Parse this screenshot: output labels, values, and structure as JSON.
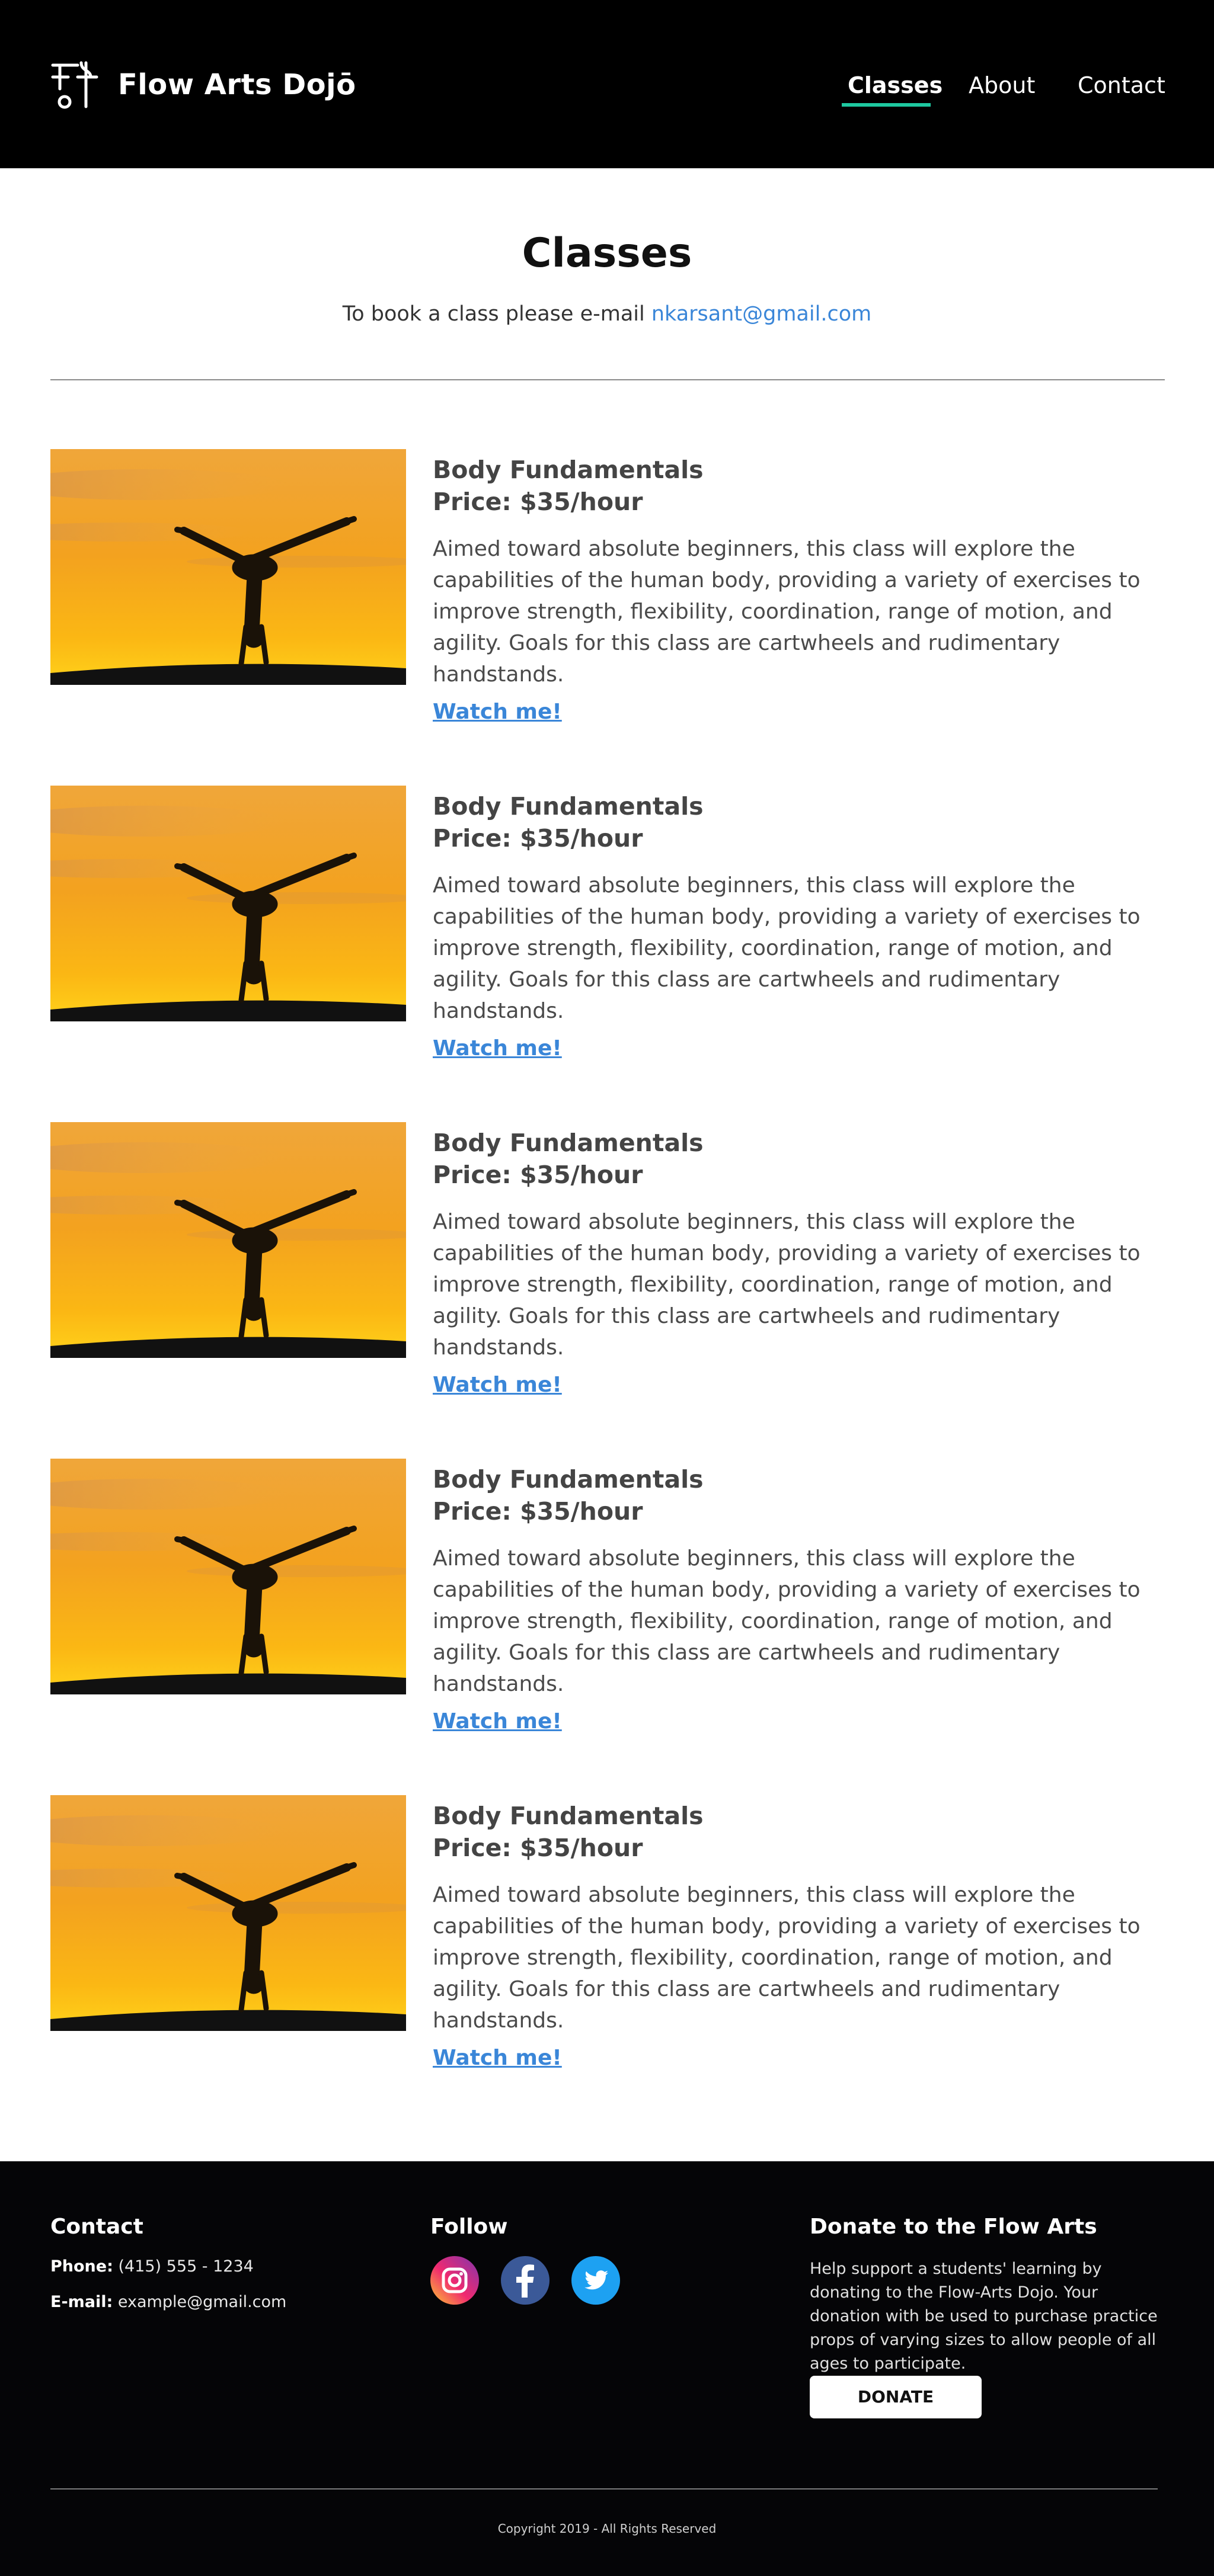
{
  "header": {
    "brand": "Flow Arts Dojō",
    "nav": [
      {
        "label": "Classes",
        "active": true
      },
      {
        "label": "About",
        "active": false
      },
      {
        "label": "Contact",
        "active": false
      }
    ],
    "accent_color": "#1ec8a0"
  },
  "main": {
    "title": "Classes",
    "intro_text": "To book a class please e-mail ",
    "intro_email": "nkarsant@gmail.com",
    "classes": [
      {
        "title": "Body Fundamentals",
        "price": "Price: $35/hour",
        "description": "Aimed toward absolute beginners, this class will explore the capabilities of the human body, providing a variety of exercises to improve strength, flexibility, coordination, range of motion, and agility. Goals for this class are cartwheels and rudimentary handstands.",
        "link": "Watch me!"
      },
      {
        "title": "Body Fundamentals",
        "price": "Price: $35/hour",
        "description": "Aimed toward absolute beginners, this class will explore the capabilities of the human body, providing a variety of exercises to improve strength, flexibility, coordination, range of motion, and agility. Goals for this class are cartwheels and rudimentary handstands.",
        "link": "Watch me!"
      },
      {
        "title": "Body Fundamentals",
        "price": "Price: $35/hour",
        "description": "Aimed toward absolute beginners, this class will explore the capabilities of the human body, providing a variety of exercises to improve strength, flexibility, coordination, range of motion, and agility. Goals for this class are cartwheels and rudimentary handstands.",
        "link": "Watch me!"
      },
      {
        "title": "Body Fundamentals",
        "price": "Price: $35/hour",
        "description": "Aimed toward absolute beginners, this class will explore the capabilities of the human body, providing a variety of exercises to improve strength, flexibility, coordination, range of motion, and agility. Goals for this class are cartwheels and rudimentary handstands.",
        "link": "Watch me!"
      },
      {
        "title": "Body Fundamentals",
        "price": "Price: $35/hour",
        "description": "Aimed toward absolute beginners, this class will explore the capabilities of the human body, providing a variety of exercises to improve strength, flexibility, coordination, range of motion, and agility. Goals for this class are cartwheels and rudimentary handstands.",
        "link": "Watch me!"
      }
    ]
  },
  "footer": {
    "contact_heading": "Contact",
    "phone_label": "Phone:",
    "phone_value": " (415) 555 - 1234",
    "email_label": "E-mail:",
    "email_value": " example@gmail.com",
    "follow_heading": "Follow",
    "social_icons": [
      "instagram-icon",
      "facebook-icon",
      "twitter-icon"
    ],
    "donate_heading": "Donate to the Flow Arts",
    "donate_text": "Help support a students' learning by donating to the Flow-Arts Dojo. Your donation with be used to purchase practice props of varying sizes to allow people of all ages to participate.",
    "donate_button": "DONATE",
    "copyright": "Copyright 2019 - All Rights Reserved"
  }
}
